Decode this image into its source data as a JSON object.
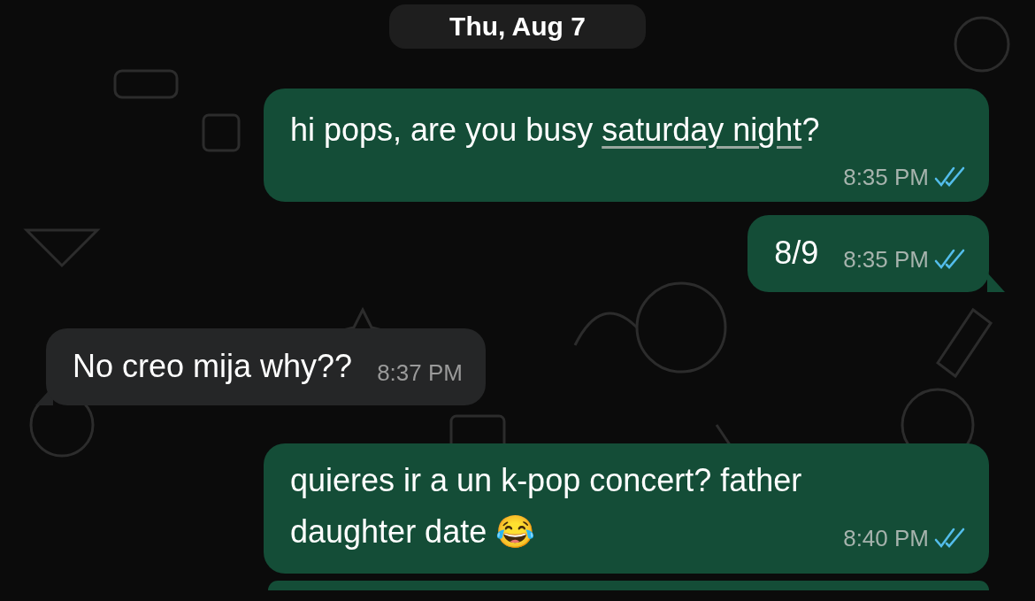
{
  "date_separator": "Thu, Aug 7",
  "messages": [
    {
      "kind": "outgoing",
      "tail": false,
      "segments": [
        {
          "kind": "plain",
          "text": "hi pops, are you busy "
        },
        {
          "kind": "link",
          "text": "saturday night"
        },
        {
          "kind": "plain",
          "text": "?"
        }
      ],
      "time": "8:35 PM",
      "read": true
    },
    {
      "kind": "outgoing",
      "tail": true,
      "segments": [
        {
          "kind": "plain",
          "text": "8/9"
        }
      ],
      "time": "8:35 PM",
      "read": true
    },
    {
      "kind": "incoming",
      "tail": true,
      "segments": [
        {
          "kind": "plain",
          "text": "No creo mija why??"
        }
      ],
      "time": "8:37 PM"
    },
    {
      "kind": "outgoing",
      "tail": false,
      "segments": [
        {
          "kind": "plain",
          "text": "quieres ir a un k-pop concert? father daughter date 😂"
        }
      ],
      "time": "8:40 PM",
      "read": true
    }
  ],
  "partial_bubble": {
    "kind": "outgoing"
  }
}
